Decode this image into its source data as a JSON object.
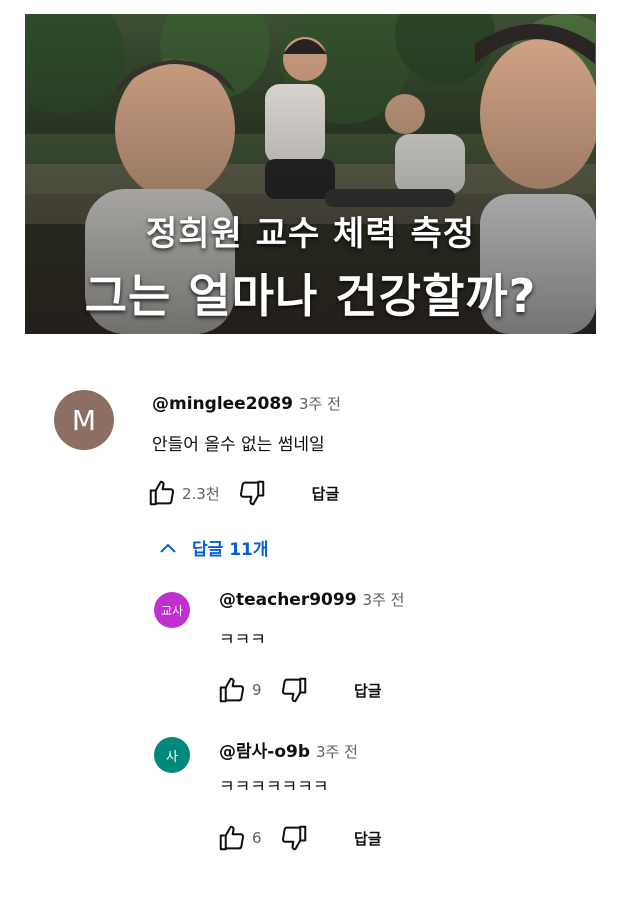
{
  "thumbnail": {
    "title_line1": "정희원 교수 체력 측정",
    "title_line2": "그는 얼마나 건강할까?"
  },
  "comment": {
    "avatar_letter": "M",
    "avatar_color": "#8d6e63",
    "handle": "@minglee2089",
    "time": "3주 전",
    "text": "안들어 올수 없는 썸네일",
    "likes": "2.3천",
    "reply_label": "답글",
    "replies_toggle": "답글 11개"
  },
  "replies": [
    {
      "avatar_text": "교사",
      "avatar_color": "#c02fcf",
      "handle": "@teacher9099",
      "time": "3주 전",
      "text": "ㅋㅋㅋ",
      "likes": "9",
      "reply_label": "답글"
    },
    {
      "avatar_text": "사",
      "avatar_color": "#00897b",
      "handle": "@람사-o9b",
      "time": "3주 전",
      "text": "ㅋㅋㅋㅋㅋㅋㅋ",
      "likes": "6",
      "reply_label": "답글"
    }
  ]
}
